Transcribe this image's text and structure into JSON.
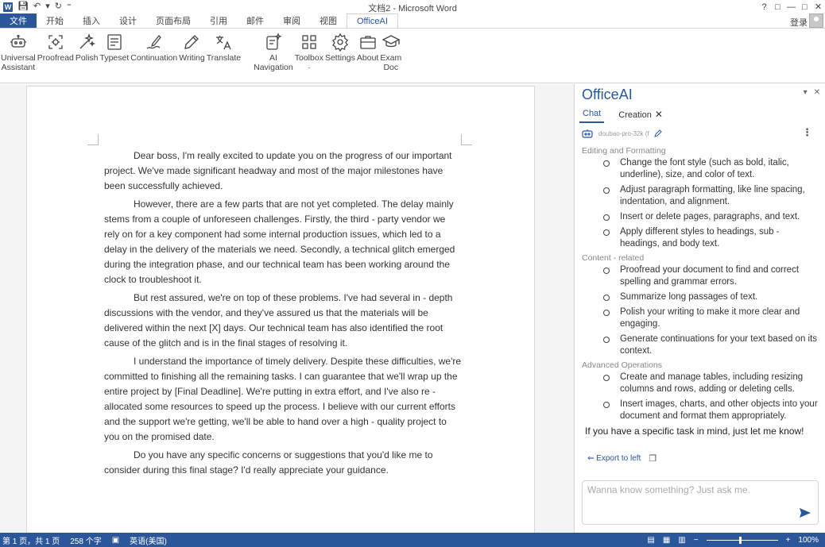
{
  "window": {
    "title": "文档2 - Microsoft Word",
    "controls": [
      "?",
      "□",
      "—",
      "□",
      "✕"
    ]
  },
  "tabs": {
    "items": [
      "文件",
      "开始",
      "插入",
      "设计",
      "页面布局",
      "引用",
      "邮件",
      "审阅",
      "视图",
      "OfficeAI"
    ],
    "active": "OfficeAI",
    "login": "登录"
  },
  "ribbon": {
    "buttons": [
      {
        "label": "Universal\nAssistant",
        "icon": "robot-icon"
      },
      {
        "label": "Proofread",
        "icon": "proofread-icon"
      },
      {
        "label": "Polish",
        "icon": "sparkle-icon"
      },
      {
        "label": "Typeset",
        "icon": "typeset-icon"
      },
      {
        "label": "Continuation",
        "icon": "continuation-icon"
      },
      {
        "label": "Writing",
        "icon": "pencil-icon"
      },
      {
        "label": "Translate",
        "icon": "translate-icon"
      },
      {
        "label": "AI\nNavigation",
        "icon": "ai-navigation-icon"
      },
      {
        "label": "Toolbox\n·",
        "icon": "toolbox-icon"
      },
      {
        "label": "Settings",
        "icon": "gear-icon"
      },
      {
        "label": "About",
        "icon": "about-icon"
      },
      {
        "label": "Exam\nDoc",
        "icon": "graduation-cap-icon"
      }
    ]
  },
  "document": {
    "paragraphs": [
      "Dear boss, I'm really excited to update you on the progress of our important project. We've made significant headway and most of the major milestones have been successfully achieved.",
      "However, there are a few parts that are not yet completed. The delay mainly stems from a couple of unforeseen challenges. Firstly, the third - party vendor we rely on for a key component had some internal production issues, which led to a delay in the delivery of the materials we need. Secondly, a technical glitch emerged during the integration phase, and our technical team has been working around the clock to troubleshoot it.",
      "But rest assured, we're on top of these problems. I've had several in - depth discussions with the vendor, and they've assured us that the materials will be delivered within the next [X] days. Our technical team has also identified the root cause of the glitch and is in the final stages of resolving it.",
      "I understand the importance of timely delivery. Despite these difficulties, we're committed to finishing all the remaining tasks. I can guarantee that we'll wrap up the entire project by [Final Deadline]. We're putting in extra effort, and I've also re - allocated some resources to speed up the process. I believe with our current efforts and the support we're getting, we'll be able to hand over a high - quality project to you on the promised date.",
      "Do you have any specific concerns or suggestions that you'd like me to consider during this final stage? I'd really appreciate your guidance."
    ]
  },
  "panel": {
    "title": "OfficeAI",
    "tabs": [
      "Chat",
      "Creation"
    ],
    "model": "doubao-pro-32k (f",
    "sections": [
      {
        "heading": "Editing and Formatting",
        "items": [
          "Change the font style (such as bold, italic, underline), size, and color of text.",
          "Adjust paragraph formatting, like line spacing, indentation, and alignment.",
          "Insert or delete pages, paragraphs, and text.",
          "Apply different styles to headings, sub - headings, and body text."
        ]
      },
      {
        "heading": "Content - related",
        "items": [
          "Proofread your document to find and correct spelling and grammar errors.",
          "Summarize long passages of text.",
          "Polish your writing to make it more clear and engaging.",
          "Generate continuations for your text based on its context."
        ]
      },
      {
        "heading": "Advanced Operations",
        "items": [
          "Create and manage tables, including resizing columns and rows, adding or deleting cells.",
          "Insert images, charts, and other objects into your document and format them appropriately."
        ]
      }
    ],
    "closing": "If you have a specific task in mind, just let me know!",
    "export_label": "Export to left",
    "input_placeholder": "Wanna know something? Just ask me."
  },
  "status": {
    "page": "第 1 页，共 1 页",
    "words": "258 个字",
    "language": "英语(美国)",
    "zoom": "100%",
    "zoom_fraction": 0.47
  }
}
